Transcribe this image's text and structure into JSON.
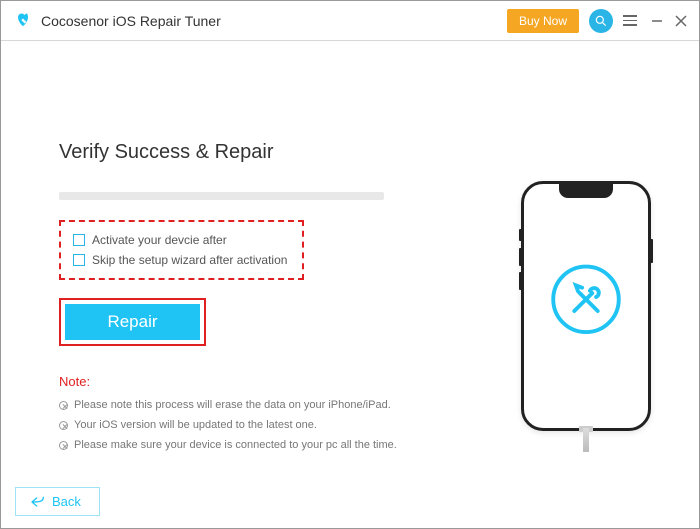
{
  "titlebar": {
    "app_name": "Cocosenor iOS Repair Tuner",
    "buy_now": "Buy Now"
  },
  "main": {
    "heading": "Verify Success & Repair",
    "checkboxes": {
      "activate": "Activate your devcie after",
      "skip_wizard": "Skip the setup wizard after activation"
    },
    "repair_label": "Repair",
    "note_label": "Note:",
    "notes": [
      "Please note this process will erase the data on your iPhone/iPad.",
      "Your iOS version will be updated to the latest one.",
      "Please make sure your device is connected to your pc all the time."
    ]
  },
  "footer": {
    "back": "Back"
  }
}
